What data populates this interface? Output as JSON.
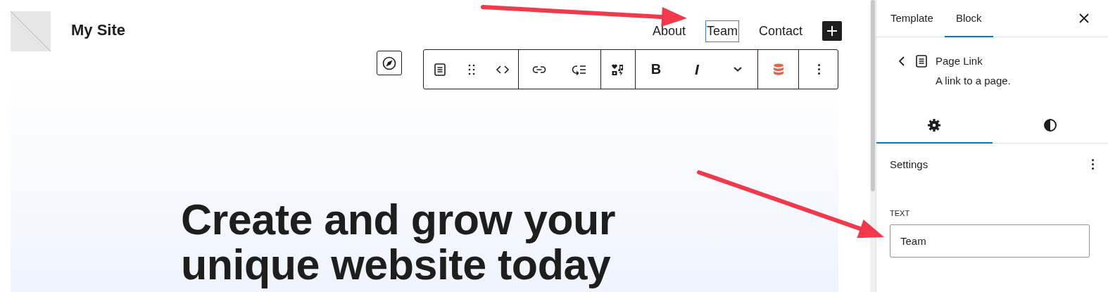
{
  "site": {
    "title": "My Site"
  },
  "nav": [
    {
      "label": "About",
      "selected": false
    },
    {
      "label": "Team",
      "selected": true
    },
    {
      "label": "Contact",
      "selected": false
    }
  ],
  "toolbar": {
    "bold": "B",
    "italic": "I"
  },
  "hero": {
    "heading": "Create and grow your unique website today"
  },
  "sidebar": {
    "tabs": [
      {
        "label": "Template",
        "selected": false
      },
      {
        "label": "Block",
        "selected": true
      }
    ],
    "block": {
      "name": "Page Link",
      "description": "A link to a page."
    },
    "panel_tabs": [
      {
        "kind": "settings",
        "selected": true
      },
      {
        "kind": "styles",
        "selected": false
      }
    ],
    "section": {
      "title": "Settings"
    },
    "field": {
      "label": "TEXT",
      "value": "Team"
    }
  }
}
